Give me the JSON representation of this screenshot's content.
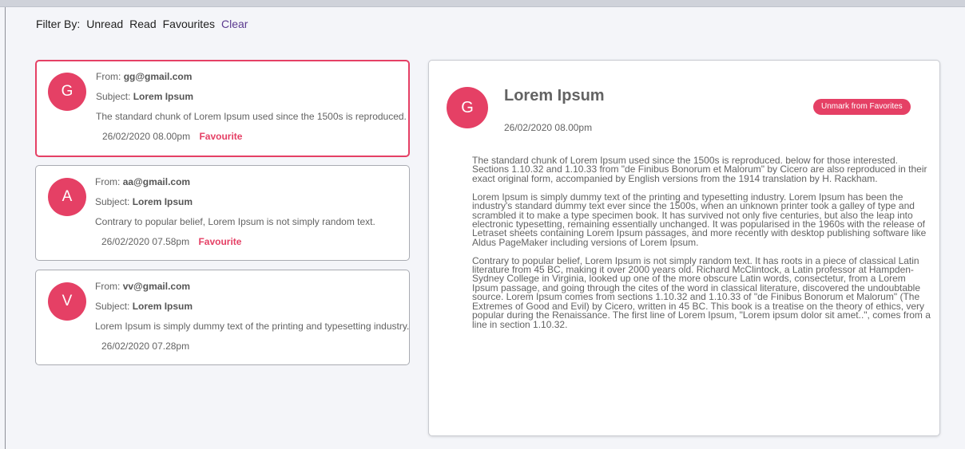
{
  "filter": {
    "label": "Filter By:",
    "options": [
      "Unread",
      "Read",
      "Favourites"
    ],
    "clear": "Clear"
  },
  "emails": [
    {
      "initial": "G",
      "from_label": "From:",
      "from": "gg@gmail.com",
      "subject_label": "Subject:",
      "subject": "Lorem Ipsum",
      "snippet": "The standard chunk of Lorem Ipsum used since the 1500s is reproduced.",
      "date": "26/02/2020 08.00pm",
      "favourite": "Favourite",
      "selected": true
    },
    {
      "initial": "A",
      "from_label": "From:",
      "from": "aa@gmail.com",
      "subject_label": "Subject:",
      "subject": "Lorem Ipsum",
      "snippet": "Contrary to popular belief, Lorem Ipsum is not simply random text.",
      "date": "26/02/2020 07.58pm",
      "favourite": "Favourite",
      "selected": false
    },
    {
      "initial": "V",
      "from_label": "From:",
      "from": "vv@gmail.com",
      "subject_label": "Subject:",
      "subject": "Lorem Ipsum",
      "snippet": "Lorem Ipsum is simply dummy text of the printing and typesetting industry.",
      "date": "26/02/2020 07.28pm",
      "favourite": "",
      "selected": false
    }
  ],
  "detail": {
    "initial": "G",
    "title": "Lorem Ipsum",
    "date": "26/02/2020 08.00pm",
    "unmark_label": "Unmark from Favorites",
    "paragraphs": [
      "The standard chunk of Lorem Ipsum used since the 1500s is reproduced. below for those interested. Sections 1.10.32 and 1.10.33 from \"de Finibus Bonorum et Malorum\" by Cicero are also reproduced in their exact original form, accompanied by English versions from the 1914 translation by H. Rackham.",
      "Lorem Ipsum is simply dummy text of the printing and typesetting industry. Lorem Ipsum has been the industry's standard dummy text ever since the 1500s, when an unknown printer took a galley of type and scrambled it to make a type specimen book. It has survived not only five centuries, but also the leap into electronic typesetting, remaining essentially unchanged. It was popularised in the 1960s with the release of Letraset sheets containing Lorem Ipsum passages, and more recently with desktop publishing software like Aldus PageMaker including versions of Lorem Ipsum.",
      "Contrary to popular belief, Lorem Ipsum is not simply random text. It has roots in a piece of classical Latin literature from 45 BC, making it over 2000 years old. Richard McClintock, a Latin professor at Hampden-Sydney College in Virginia, looked up one of the more obscure Latin words, consectetur, from a Lorem Ipsum passage, and going through the cites of the word in classical literature, discovered the undoubtable source. Lorem Ipsum comes from sections 1.10.32 and 1.10.33 of \"de Finibus Bonorum et Malorum\" (The Extremes of Good and Evil) by Cicero, written in 45 BC. This book is a treatise on the theory of ethics, very popular during the Renaissance. The first line of Lorem Ipsum, \"Lorem ipsum dolor sit amet..\", comes from a line in section 1.10.32."
    ]
  },
  "colors": {
    "accent": "#e54065",
    "background": "#f4f5f9",
    "text": "#636363",
    "clear_link": "#5b3a8f"
  }
}
